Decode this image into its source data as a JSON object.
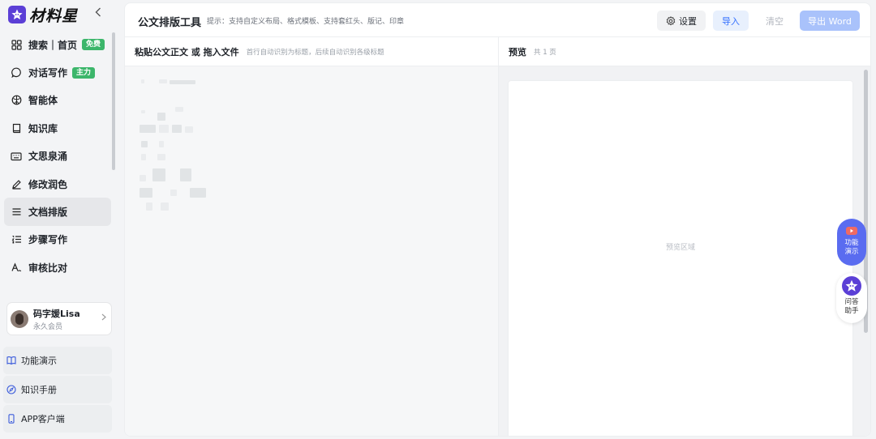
{
  "app": {
    "logo_text": "材料星",
    "collapse_icon": "chevron-left-icon"
  },
  "sidebar": {
    "items": [
      {
        "label": "搜索｜首页",
        "icon": "grid-icon",
        "badge": "免费"
      },
      {
        "label": "对话写作",
        "icon": "chat-bubble-icon",
        "badge": "主力"
      },
      {
        "label": "智能体",
        "icon": "globe-icon"
      },
      {
        "label": "知识库",
        "icon": "book-icon"
      },
      {
        "label": "文思泉涌",
        "icon": "keyboard-icon"
      },
      {
        "label": "修改润色",
        "icon": "pen-icon"
      },
      {
        "label": "文档排版",
        "icon": "lines-icon",
        "active": true
      },
      {
        "label": "步骤写作",
        "icon": "numbered-list-icon"
      },
      {
        "label": "审核比对",
        "icon": "text-compare-icon"
      }
    ],
    "badge_color": "#3cb66b",
    "user": {
      "name": "码字媛Lisa",
      "level": "永久会员"
    },
    "bottom_links": [
      {
        "label": "功能演示",
        "icon": "open-book-icon"
      },
      {
        "label": "知识手册",
        "icon": "compass-icon"
      },
      {
        "label": "APP客户端",
        "icon": "phone-icon"
      }
    ]
  },
  "toolbar": {
    "title": "公文排版工具",
    "hint": "提示：支持自定义布局、格式模板、支持套红头、版记、印章",
    "settings_label": "设置",
    "import_label": "导入",
    "clear_label": "清空",
    "export_label": "导出 Word",
    "accent_color": "#3370ff"
  },
  "editor": {
    "title": "粘贴公文正文 或 拖入文件",
    "subtitle": "首行自动识别为标题，后续自动识别各级标题"
  },
  "preview": {
    "title": "预览",
    "page_count": "共 1 页",
    "empty_text": "预览区域"
  },
  "floating": {
    "demo_label_1": "功能",
    "demo_label_2": "演示",
    "help_label_1": "问答",
    "help_label_2": "助手"
  }
}
